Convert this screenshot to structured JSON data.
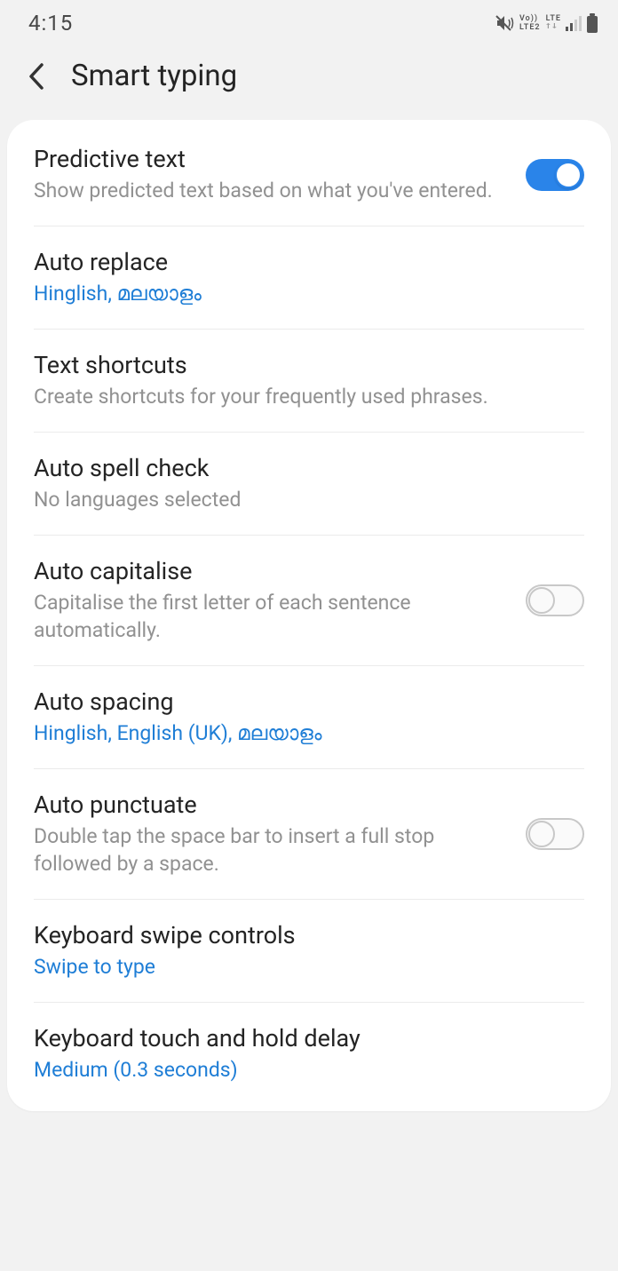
{
  "status": {
    "time": "4:15",
    "network": "LTE",
    "sim": "LTE2",
    "voice": "Vo))"
  },
  "header": {
    "title": "Smart typing"
  },
  "rows": {
    "predictive": {
      "title": "Predictive text",
      "subtitle": "Show predicted text based on what you've entered."
    },
    "autoreplace": {
      "title": "Auto replace",
      "subtitle": "Hinglish, മലയാളം"
    },
    "shortcuts": {
      "title": "Text shortcuts",
      "subtitle": "Create shortcuts for your frequently used phrases."
    },
    "spellcheck": {
      "title": "Auto spell check",
      "subtitle": "No languages selected"
    },
    "capitalise": {
      "title": "Auto capitalise",
      "subtitle": "Capitalise the first letter of each sentence automatically."
    },
    "spacing": {
      "title": "Auto spacing",
      "subtitle": "Hinglish, English (UK), മലയാളം"
    },
    "punctuate": {
      "title": "Auto punctuate",
      "subtitle": "Double tap the space bar to insert a full stop followed by a space."
    },
    "swipe": {
      "title": "Keyboard swipe controls",
      "subtitle": "Swipe to type"
    },
    "holddelay": {
      "title": "Keyboard touch and hold delay",
      "subtitle": "Medium (0.3 seconds)"
    }
  }
}
